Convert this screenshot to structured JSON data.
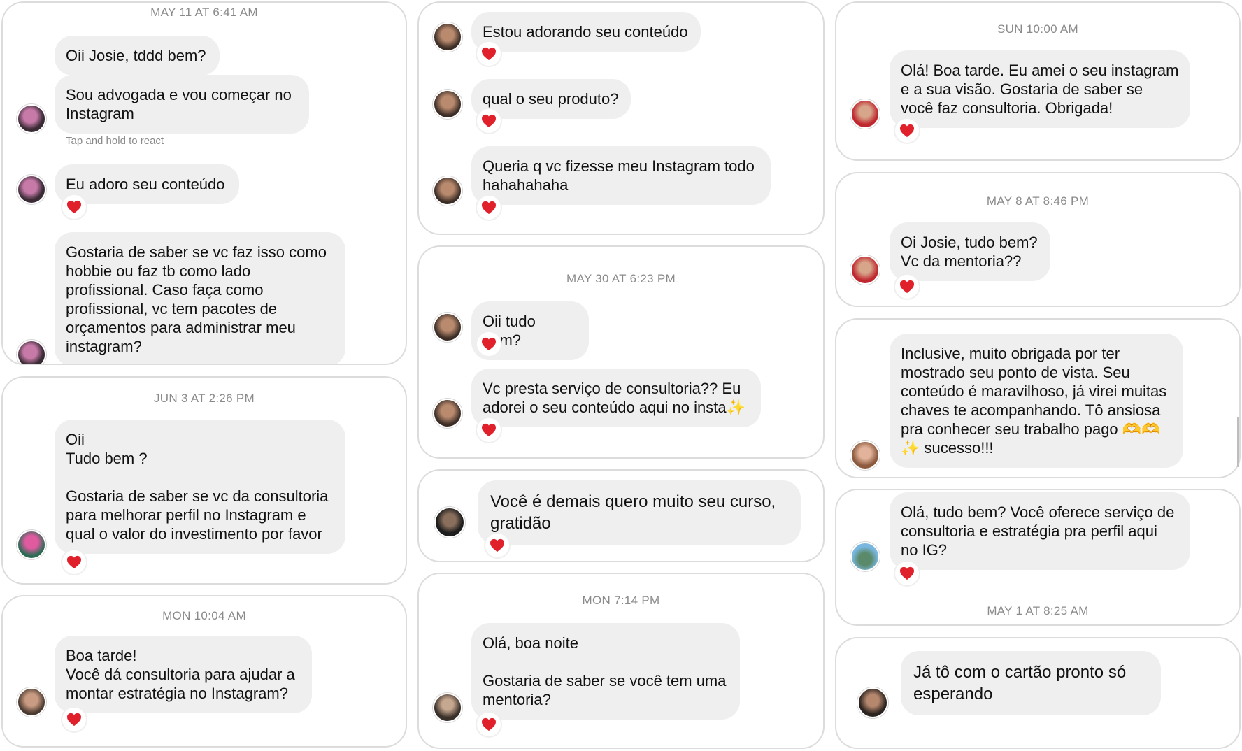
{
  "colors": {
    "bubble": "#efefef",
    "heart": "#e0202b",
    "timestamp": "#8a8a8a",
    "card_border": "#dcdcdc"
  },
  "column1": {
    "card1": {
      "timestamp": "MAY 11 AT 6:41 AM",
      "msg1": "Oii Josie, tddd bem?",
      "msg2": "Sou advogada e vou começar no\nInstagram",
      "hint": "Tap and hold to react",
      "msg3": "Eu adoro seu conteúdo",
      "msg4": "Gostaria de saber se vc faz isso como\nhobbie ou faz tb como lado\nprofissional. Caso faça como\nprofissional, vc tem pacotes de\norçamentos para administrar meu\ninstagram?"
    },
    "card2": {
      "timestamp": "JUN 3 AT 2:26 PM",
      "msg1": "Oii\nTudo bem ?\n\nGostaria de saber se vc da consultoria\npara melhorar perfil no Instagram e\nqual o valor do investimento por favor"
    },
    "card3": {
      "timestamp": "MON 10:04 AM",
      "msg1": "Boa tarde!\nVocê dá consultoria para ajudar a\nmontar estratégia no Instagram?"
    }
  },
  "column2": {
    "card1": {
      "msg1": "Estou adorando seu conteúdo",
      "msg2": "qual o seu produto?",
      "msg3": "Queria q vc fizesse meu Instagram todo\nhahahahaha"
    },
    "card2": {
      "timestamp": "MAY 30 AT 6:23 PM",
      "msg1": "Oii tudo bem?",
      "msg2": "Vc presta serviço de consultoria?? Eu\nadorei o seu conteúdo aqui no insta✨"
    },
    "card3": {
      "msg1": "Você é demais quero muito seu curso,\ngratidão"
    },
    "card4": {
      "timestamp": "MON 7:14 PM",
      "msg1": "Olá, boa noite\n\nGostaria de saber se você tem uma\nmentoria?"
    }
  },
  "column3": {
    "card1": {
      "timestamp": "SUN 10:00 AM",
      "msg1": "Olá! Boa tarde. Eu amei o seu instagram\ne a sua visão. Gostaria de saber se\nvocê faz consultoria. Obrigada!"
    },
    "card2": {
      "timestamp": "MAY 8 AT 8:46 PM",
      "msg1": "Oi Josie, tudo bem?\nVc da mentoria??"
    },
    "card3": {
      "msg1": "Inclusive, muito obrigada por ter\nmostrado seu ponto de vista. Seu\nconteúdo é maravilhoso, já virei muitas\nchaves te acompanhando. Tô ansiosa\npra conhecer seu trabalho pago 🫶🫶\n✨ sucesso!!!"
    },
    "card4": {
      "msg1": "Olá, tudo bem? Você oferece serviço de\nconsultoria e estratégia pra perfil aqui\nno IG?",
      "timestamp_after": "MAY 1 AT 8:25 AM"
    },
    "card5": {
      "msg1": "Já tô com o cartão pronto só\nesperando"
    }
  }
}
